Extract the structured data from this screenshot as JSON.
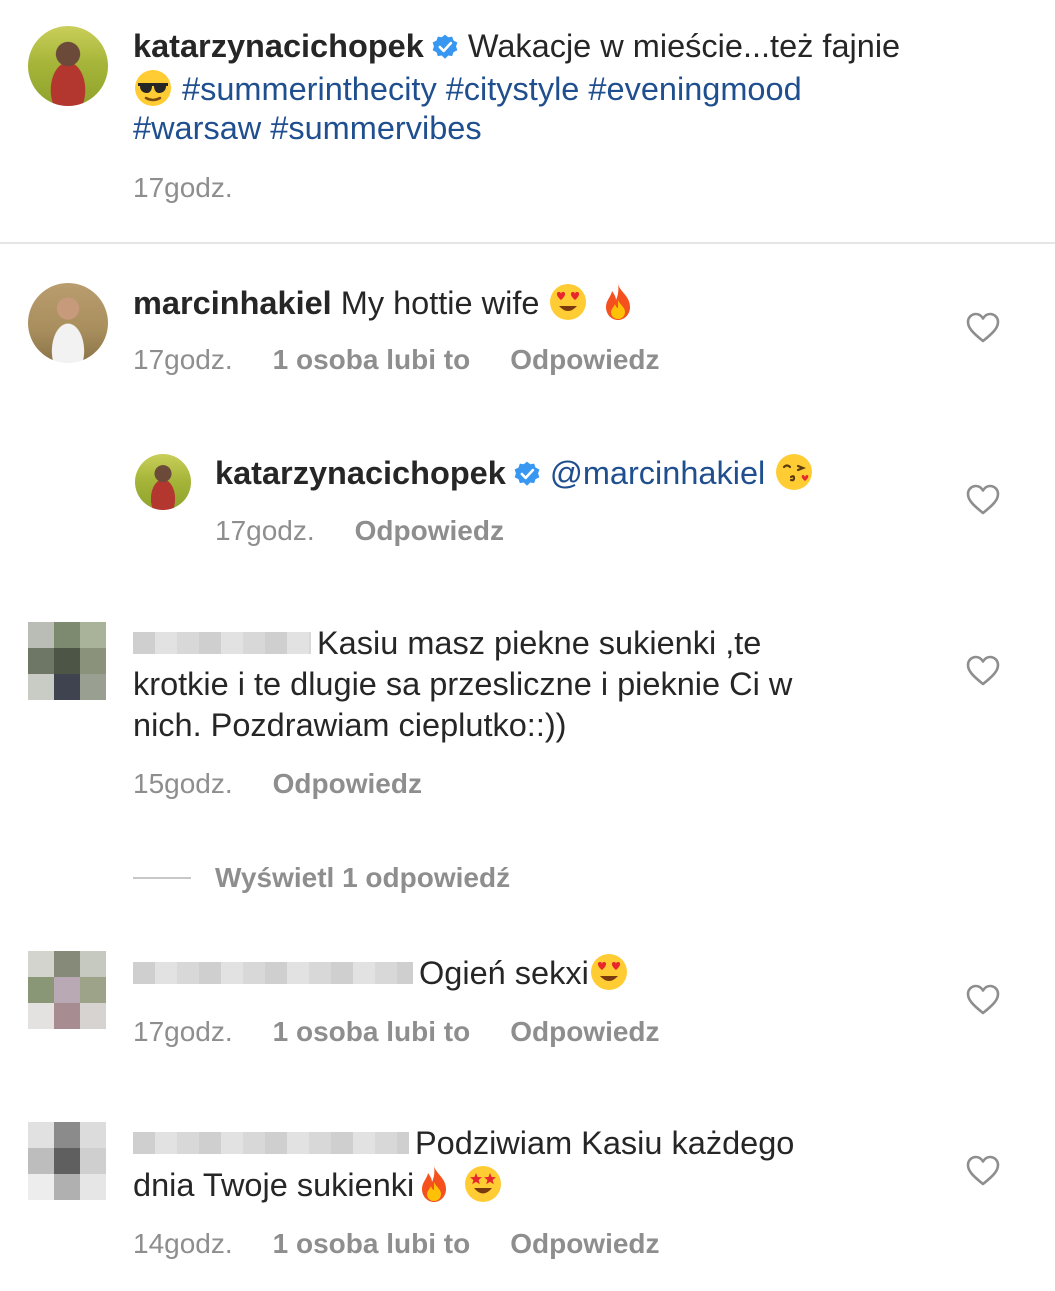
{
  "post": {
    "username": "katarzynacichopek",
    "caption_start": "Wakacje w mieście...też fajnie",
    "emoji_1": "sunglasses-emoji",
    "hashtags_line1": [
      "#summerinthecity",
      "#citystyle",
      "#eveningmood"
    ],
    "hashtags_line2": [
      "#warsaw",
      "#summervibes"
    ],
    "time": "17godz."
  },
  "comments": [
    {
      "username": "marcinhakiel",
      "text": "My hottie wife",
      "emojis": [
        "heart-eyes-emoji",
        "fire-emoji"
      ],
      "time": "17godz.",
      "likes": "1 osoba lubi to",
      "reply": "Odpowiedz"
    },
    {
      "username": "katarzynacichopek",
      "mention": "@marcinhakiel",
      "emojis": [
        "kissing-heart-emoji"
      ],
      "time": "17godz.",
      "reply": "Odpowiedz"
    },
    {
      "text_line1": "Kasiu masz piekne sukienki ,te",
      "text_line2": "krotkie i te dlugie sa przesliczne i pieknie Ci w",
      "text_line3": "nich. Pozdrawiam cieplutko::))",
      "time": "15godz.",
      "reply": "Odpowiedz",
      "view_replies": "Wyświetl 1 odpowiedź"
    },
    {
      "text": "Ogień sekxi",
      "emojis": [
        "heart-eyes-emoji"
      ],
      "time": "17godz.",
      "likes": "1 osoba lubi to",
      "reply": "Odpowiedz"
    },
    {
      "text_line1": "Podziwiam Kasiu każdego",
      "text_line2": "dnia Twoje sukienki",
      "emojis": [
        "fire-emoji",
        "star-struck-emoji"
      ],
      "time": "14godz.",
      "likes": "1 osoba lubi to",
      "reply": "Odpowiedz"
    }
  ],
  "colors": {
    "text": "#262626",
    "meta": "#8e8e8e",
    "hashtag": "#1f4f8f",
    "verified": "#3897f0"
  }
}
